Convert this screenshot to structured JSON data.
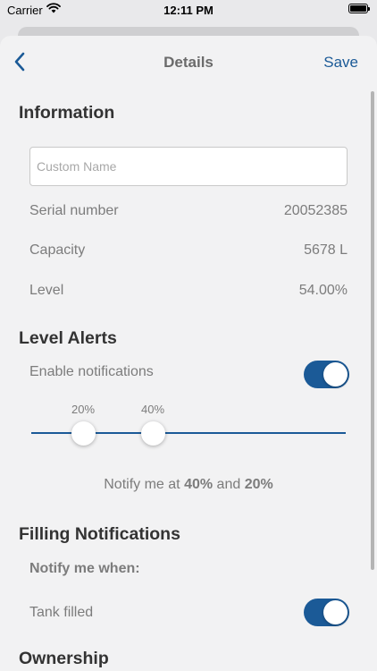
{
  "status_bar": {
    "carrier": "Carrier",
    "time": "12:11 PM",
    "wifi_icon": "wifi-icon",
    "battery_icon": "battery-icon"
  },
  "nav": {
    "title": "Details",
    "save_label": "Save",
    "back_icon": "chevron-left-icon"
  },
  "information": {
    "title": "Information",
    "name_placeholder": "Custom Name",
    "name_value": "",
    "rows": [
      {
        "label": "Serial number",
        "value": "20052385"
      },
      {
        "label": "Capacity",
        "value": "5678 L"
      },
      {
        "label": "Level",
        "value": "54.00%"
      }
    ]
  },
  "level_alerts": {
    "title": "Level Alerts",
    "enable_label": "Enable notifications",
    "enabled": true,
    "thresholds": [
      {
        "label": "20%",
        "value": 20
      },
      {
        "label": "40%",
        "value": 40
      }
    ],
    "summary_prefix": "Notify me at",
    "summary_high": "40%",
    "summary_and": "and",
    "summary_low": "20%"
  },
  "filling": {
    "title": "Filling Notifications",
    "subtitle": "Notify me when:",
    "tank_filled_label": "Tank filled",
    "tank_filled_enabled": true
  },
  "ownership": {
    "title": "Ownership"
  },
  "colors": {
    "accent": "#1b5a97",
    "background": "#f2f2f3"
  }
}
